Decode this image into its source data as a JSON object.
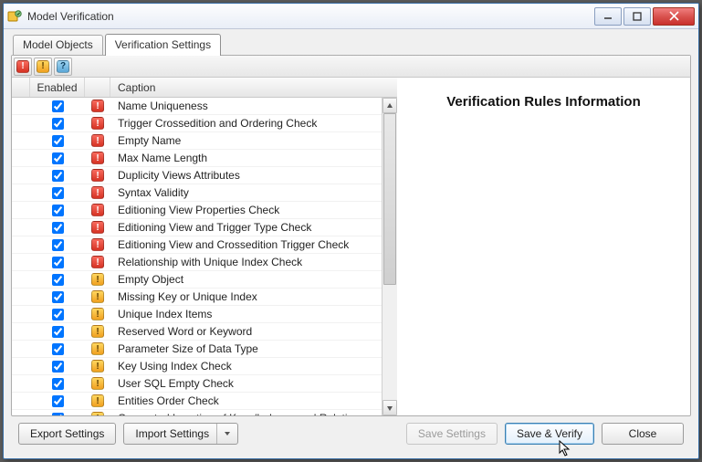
{
  "window": {
    "title": "Model Verification"
  },
  "tabs": [
    {
      "label": "Model Objects",
      "active": false
    },
    {
      "label": "Verification Settings",
      "active": true
    }
  ],
  "grid": {
    "columns": {
      "enabled": "Enabled",
      "caption": "Caption"
    },
    "rules": [
      {
        "enabled": true,
        "severity": "error",
        "caption": "Name Uniqueness"
      },
      {
        "enabled": true,
        "severity": "error",
        "caption": "Trigger Crossedition and Ordering Check"
      },
      {
        "enabled": true,
        "severity": "error",
        "caption": "Empty Name"
      },
      {
        "enabled": true,
        "severity": "error",
        "caption": "Max Name Length"
      },
      {
        "enabled": true,
        "severity": "error",
        "caption": "Duplicity Views Attributes"
      },
      {
        "enabled": true,
        "severity": "error",
        "caption": "Syntax Validity"
      },
      {
        "enabled": true,
        "severity": "error",
        "caption": "Editioning View Properties Check"
      },
      {
        "enabled": true,
        "severity": "error",
        "caption": "Editioning View and Trigger Type Check"
      },
      {
        "enabled": true,
        "severity": "error",
        "caption": "Editioning View and Crossedition Trigger Check"
      },
      {
        "enabled": true,
        "severity": "error",
        "caption": "Relationship with Unique Index Check"
      },
      {
        "enabled": true,
        "severity": "warn",
        "caption": "Empty Object"
      },
      {
        "enabled": true,
        "severity": "warn",
        "caption": "Missing Key or Unique Index"
      },
      {
        "enabled": true,
        "severity": "warn",
        "caption": "Unique Index Items"
      },
      {
        "enabled": true,
        "severity": "warn",
        "caption": "Reserved Word or Keyword"
      },
      {
        "enabled": true,
        "severity": "warn",
        "caption": "Parameter Size of Data Type"
      },
      {
        "enabled": true,
        "severity": "warn",
        "caption": "Key Using Index Check"
      },
      {
        "enabled": true,
        "severity": "warn",
        "caption": "User SQL Empty Check"
      },
      {
        "enabled": true,
        "severity": "warn",
        "caption": "Entities Order Check"
      },
      {
        "enabled": true,
        "severity": "warn",
        "caption": "Generated Location of Keys/Indexes and Relationships Ch..."
      }
    ]
  },
  "info": {
    "title": "Verification Rules Information"
  },
  "footer": {
    "export": "Export Settings",
    "import": "Import Settings",
    "save_settings": "Save Settings",
    "save_verify": "Save & Verify",
    "close": "Close"
  },
  "toolbar": {
    "error_glyph": "!",
    "warn_glyph": "!",
    "info_glyph": "?"
  }
}
